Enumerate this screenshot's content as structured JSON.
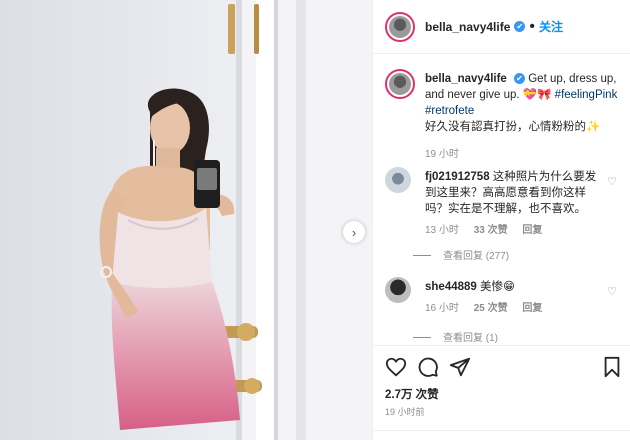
{
  "header": {
    "username": "bella_navy4life",
    "verified_mark": "✔",
    "dot": "•",
    "follow_label": "关注"
  },
  "caption": {
    "username": "bella_navy4life",
    "text": "Get up, dress up, and never give up.",
    "emoji": "💝🎀",
    "hashtag1": "#feelingPink",
    "hashtag2": "#retrofete",
    "line2": "好久没有認真打扮，心情粉粉的✨",
    "time": "19 小时"
  },
  "comments": [
    {
      "username": "fj021912758",
      "text": "这种照片为什么要发到这里来？高高愿意看到你这样吗？实在是不理解，也不喜欢。",
      "time": "13 小时",
      "likes": "33 次赞",
      "reply_label": "回复",
      "view_replies": "查看回复 (277)"
    },
    {
      "username": "she44889",
      "text": "美惨😁",
      "time": "16 小时",
      "likes": "25 次赞",
      "reply_label": "回复",
      "view_replies": "查看回复 (1)"
    }
  ],
  "actions": {
    "likes": "2.7万 次赞",
    "timestamp": "19 小时前"
  },
  "icons": {
    "heart": "heart-icon",
    "comment": "comment-icon",
    "share": "share-icon",
    "save": "bookmark-icon",
    "next": "chevron-right-icon"
  },
  "colors": {
    "accent": "#0095f6",
    "verified": "#3897f0",
    "story_ring": "#e1306c",
    "muted": "#8e8e8e"
  }
}
